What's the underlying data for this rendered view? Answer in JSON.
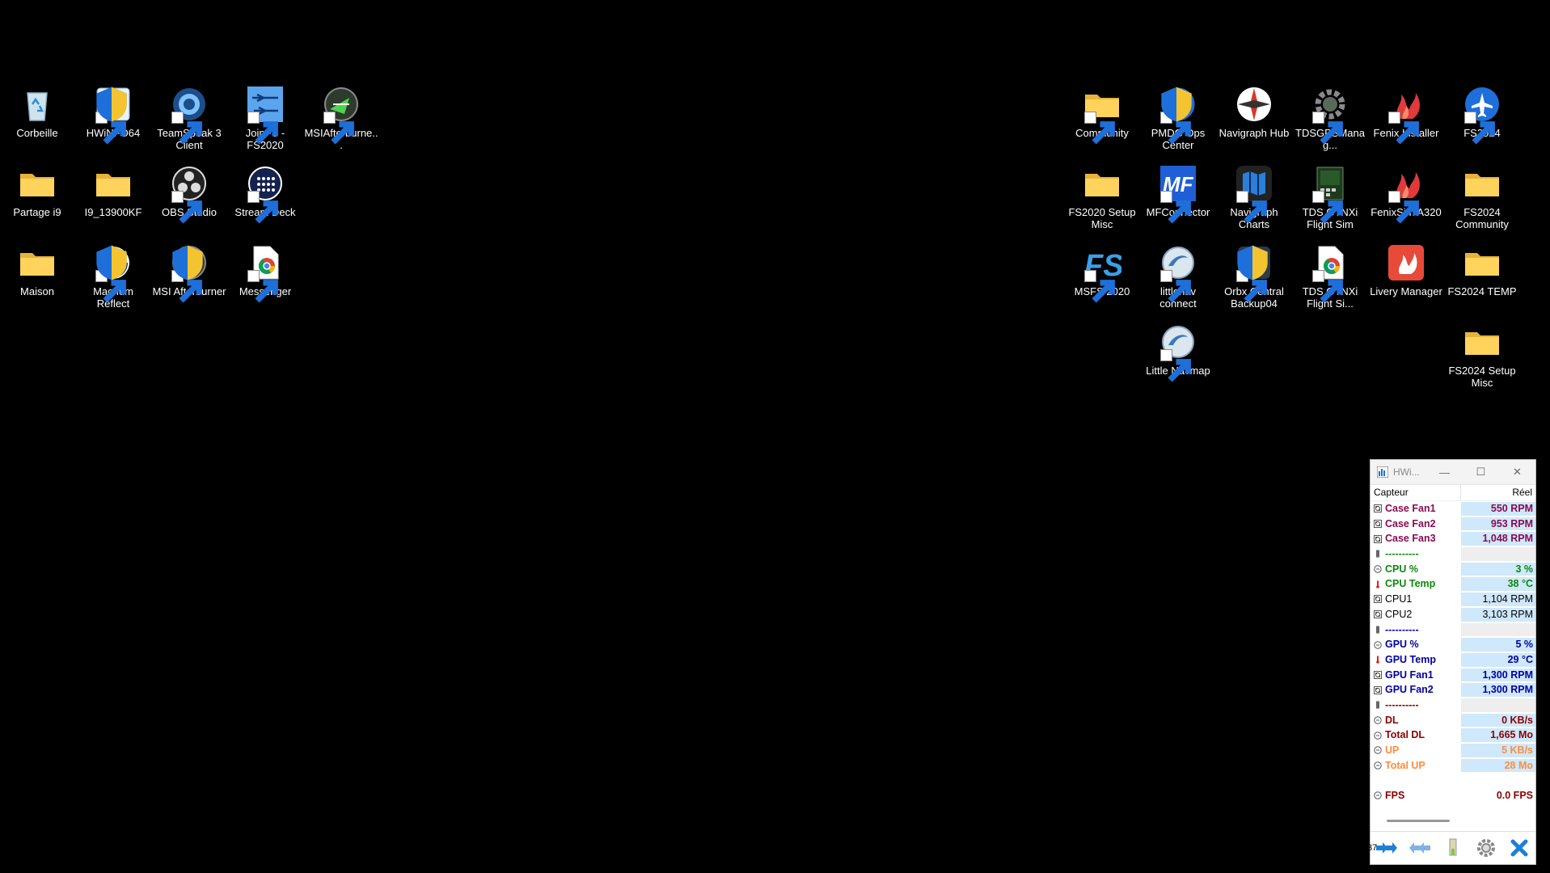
{
  "desktop": {
    "left_icons": [
      {
        "label": "Corbeille",
        "icon": "recycle-bin-icon"
      },
      {
        "label": "HWiNFO64",
        "icon": "hwinfo-icon"
      },
      {
        "label": "TeamSpeak 3 Client",
        "icon": "teamspeak-icon"
      },
      {
        "label": "JoinFS - FS2020",
        "icon": "joinfs-icon"
      },
      {
        "label": "MSIAfterburne...",
        "icon": "afterburner-icon"
      },
      {
        "label": "Partage i9",
        "icon": "folder-icon"
      },
      {
        "label": "I9_13900KF",
        "icon": "folder-icon"
      },
      {
        "label": "OBS Studio",
        "icon": "obs-icon"
      },
      {
        "label": "Stream Deck",
        "icon": "stream-deck-icon"
      },
      {
        "label": "Maison",
        "icon": "folder-icon"
      },
      {
        "label": "Macrium Reflect",
        "icon": "macrium-icon"
      },
      {
        "label": "MSI Afterburner",
        "icon": "afterburner-icon"
      },
      {
        "label": "Messenger",
        "icon": "chrome-app-icon"
      }
    ],
    "right_icons": [
      {
        "label": "Community",
        "icon": "folder-icon"
      },
      {
        "label": "PMDG Ops Center",
        "icon": "pmdg-icon"
      },
      {
        "label": "Navigraph Hub",
        "icon": "navigraph-hub-icon"
      },
      {
        "label": "TDSGPSManag...",
        "icon": "gear-icon"
      },
      {
        "label": "Fenix Installer",
        "icon": "fenix-icon"
      },
      {
        "label": "FS2024",
        "icon": "fs2024-icon"
      },
      {
        "label": "FS2020 Setup Misc",
        "icon": "folder-icon"
      },
      {
        "label": "MFConnector",
        "icon": "mf-icon"
      },
      {
        "label": "Navigraph Charts",
        "icon": "navigraph-charts-icon"
      },
      {
        "label": "TDS GTNXi Flight Sim",
        "icon": "tds-gtnxi-icon"
      },
      {
        "label": "FenixSim A320",
        "icon": "fenix-icon"
      },
      {
        "label": "FS2024 Community",
        "icon": "folder-icon"
      },
      {
        "label": "MSFS 2020",
        "icon": "msfs-icon"
      },
      {
        "label": "littlenav connect",
        "icon": "littlenav-icon"
      },
      {
        "label": "Orbx Central Backup04",
        "icon": "orbx-icon"
      },
      {
        "label": "TDS GTNXi Flight Si...",
        "icon": "chrome-app-icon"
      },
      {
        "label": "Livery Manager",
        "icon": "livery-icon"
      },
      {
        "label": "FS2024 TEMP",
        "icon": "folder-icon"
      },
      {
        "label": "Little Navmap",
        "icon": "littlenav-icon"
      },
      {
        "label": "FS2024 Setup Misc",
        "icon": "folder-icon"
      }
    ]
  },
  "hwinfo": {
    "title": "HWi...",
    "col_sensor": "Capteur",
    "col_value": "Réel",
    "rows": [
      {
        "name": "Case Fan1",
        "value": "550 RPM",
        "color": "#8b0a4e"
      },
      {
        "name": "Case Fan2",
        "value": "953 RPM",
        "color": "#8b0a4e"
      },
      {
        "name": "Case Fan3",
        "value": "1,048 RPM",
        "color": "#8b0a4e"
      },
      {
        "name": "----------",
        "value": "",
        "color": "#0a8a0a"
      },
      {
        "name": "CPU %",
        "value": "3 %",
        "color": "#0a8a0a"
      },
      {
        "name": "CPU Temp",
        "value": "38 °C",
        "color": "#0a8a0a"
      },
      {
        "name": "CPU1",
        "value": "1,104 RPM",
        "color": "#000000"
      },
      {
        "name": "CPU2",
        "value": "3,103 RPM",
        "color": "#000000"
      },
      {
        "name": "----------",
        "value": "",
        "color": "#0000c8"
      },
      {
        "name": "GPU %",
        "value": "5 %",
        "color": "#0000a0"
      },
      {
        "name": "GPU Temp",
        "value": "29 °C",
        "color": "#0000a0"
      },
      {
        "name": "GPU Fan1",
        "value": "1,300 RPM",
        "color": "#0000a0"
      },
      {
        "name": "GPU Fan2",
        "value": "1,300 RPM",
        "color": "#0000a0"
      },
      {
        "name": "----------",
        "value": "",
        "color": "#8b0000"
      },
      {
        "name": "DL",
        "value": "0 KB/s",
        "color": "#8b0000"
      },
      {
        "name": "Total DL",
        "value": "1,665 Mo",
        "color": "#8b0000"
      },
      {
        "name": "UP",
        "value": "5 KB/s",
        "color": "#ff8c3c"
      },
      {
        "name": "Total UP",
        "value": "28 Mo",
        "color": "#ff8c3c"
      },
      {
        "name": "",
        "value": "",
        "color": "#000000"
      },
      {
        "name": "FPS",
        "value": "0.0 FPS",
        "color": "#8b0000"
      }
    ],
    "clock_fragment": "37"
  }
}
